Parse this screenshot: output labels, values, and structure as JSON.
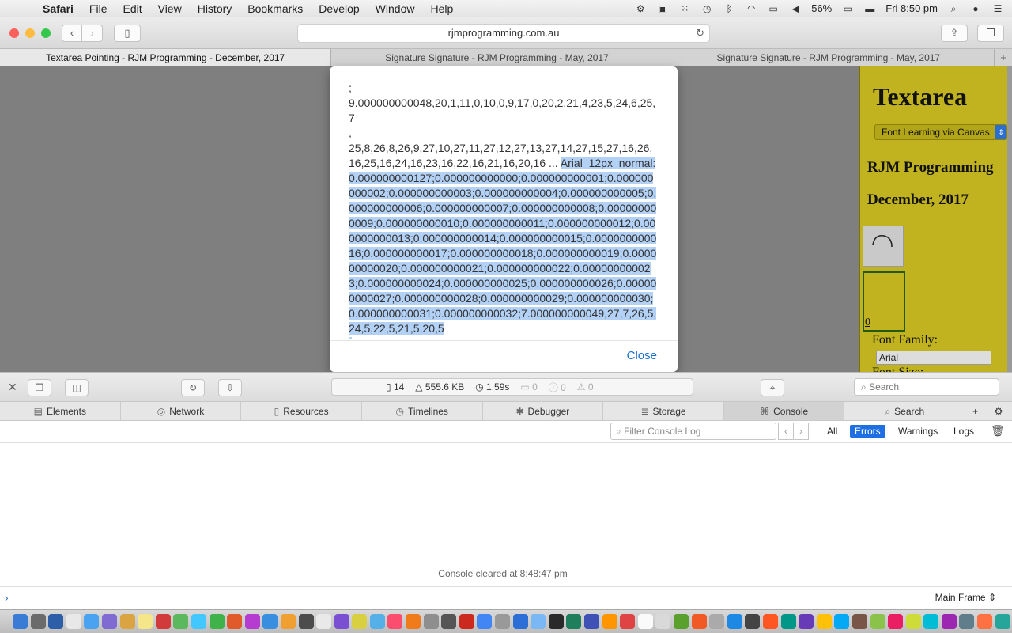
{
  "menubar": {
    "app": "Safari",
    "items": [
      "File",
      "Edit",
      "View",
      "History",
      "Bookmarks",
      "Develop",
      "Window",
      "Help"
    ],
    "battery": "56%",
    "clock": "Fri 8:50 pm"
  },
  "toolbar": {
    "url": "rjmprogramming.com.au"
  },
  "tabs": [
    {
      "label": "Textarea Pointing - RJM Programming - December, 2017",
      "active": true
    },
    {
      "label": "Signature Signature - RJM Programming - May, 2017",
      "active": false
    },
    {
      "label": "Signature Signature - RJM Programming - May, 2017",
      "active": false
    }
  ],
  "modal": {
    "text_normal": ";\n9.000000000048,20,1,11,0,10,0,9,17,0,20,2,21,4,23,5,24,6,25,7\n,\n25,8,26,8,26,9,27,10,27,11,27,12,27,13,27,14,27,15,27,16,26,16,25,16,24,16,23,16,22,16,21,16,20,16 ... ",
    "text_selected": "Arial_12px_normal:\n0.000000000127;0.000000000000;0.000000000001;0.000000000002;0.000000000003;0.000000000004;0.000000000005;0.000000000006;0.000000000007;0.000000000008;0.000000000009;0.000000000010;0.000000000011;0.000000000012;0.000000000013;0.000000000014;0.000000000015;0.000000000016;0.000000000017;0.000000000018;0.000000000019;0.000000000020;0.000000000021;0.000000000022;0.000000000023;0.000000000024;0.000000000025;0.000000000026;0.000000000027;0.000000000028;0.000000000029;0.000000000030;0.000000000031;0.000000000032;7.000000000049,27,7,26,5,24,5,22,5,21,5,20,5\n,",
    "close_label": "Close"
  },
  "side": {
    "title": "Textarea",
    "select_value": "Font Learning via Canvas",
    "heading1": "RJM Programming",
    "heading2": "December, 2017",
    "counter": "0",
    "font_family_label": "Font Family:",
    "font_family_value": "Arial",
    "font_size_label": "Font Size:"
  },
  "devtools": {
    "stats": {
      "resources": "14",
      "size": "555.6 KB",
      "time": "1.59s",
      "logs": "0",
      "errors": "0",
      "warnings": "0"
    },
    "search_placeholder": "Search",
    "tabs": [
      "Elements",
      "Network",
      "Resources",
      "Timelines",
      "Debugger",
      "Storage",
      "Console",
      "Search"
    ],
    "active_tab": "Console",
    "filter_placeholder": "Filter Console Log",
    "levels": [
      "All",
      "Errors",
      "Warnings",
      "Logs"
    ],
    "active_level": "Errors",
    "console_message": "Console cleared at 8:48:47 pm",
    "frame_select": "Main Frame"
  },
  "colors": {
    "accent": "#1d6fe3",
    "sidebar_bg": "#c1b31f",
    "selection": "#b3d1f5",
    "page_bg": "#7f7f7f"
  },
  "dock_colors": [
    "#3a7bd5",
    "#6b6b6b",
    "#2c5fa8",
    "#e8e8e8",
    "#4aa3f0",
    "#7f6bd1",
    "#d9a441",
    "#f5e68a",
    "#d13b3b",
    "#5cb85c",
    "#43c7ff",
    "#3fb24a",
    "#e05a2c",
    "#b53bd1",
    "#3a8ee0",
    "#f0a030",
    "#4c4c4c",
    "#e9e9e9",
    "#7b4fd1",
    "#d9d040",
    "#55b0e8",
    "#fb4d6d",
    "#f07b1a",
    "#8e8e8e",
    "#555555",
    "#cc2a1f",
    "#4285f4",
    "#999999",
    "#2b6fd6",
    "#7ab8f5",
    "#2a2a2a",
    "#1f7f5c",
    "#3f51b5",
    "#ff9500",
    "#e04343",
    "#fafafa",
    "#d9d9d9",
    "#5aa02c",
    "#f15a24",
    "#aaaaaa",
    "#1e88e5",
    "#444444",
    "#ff5722",
    "#009688",
    "#673ab7",
    "#ffc107",
    "#03a9f4",
    "#795548",
    "#8bc34a",
    "#e91e63",
    "#cddc39",
    "#00bcd4",
    "#9c27b0",
    "#607d8b",
    "#ff7043",
    "#26a69a"
  ]
}
